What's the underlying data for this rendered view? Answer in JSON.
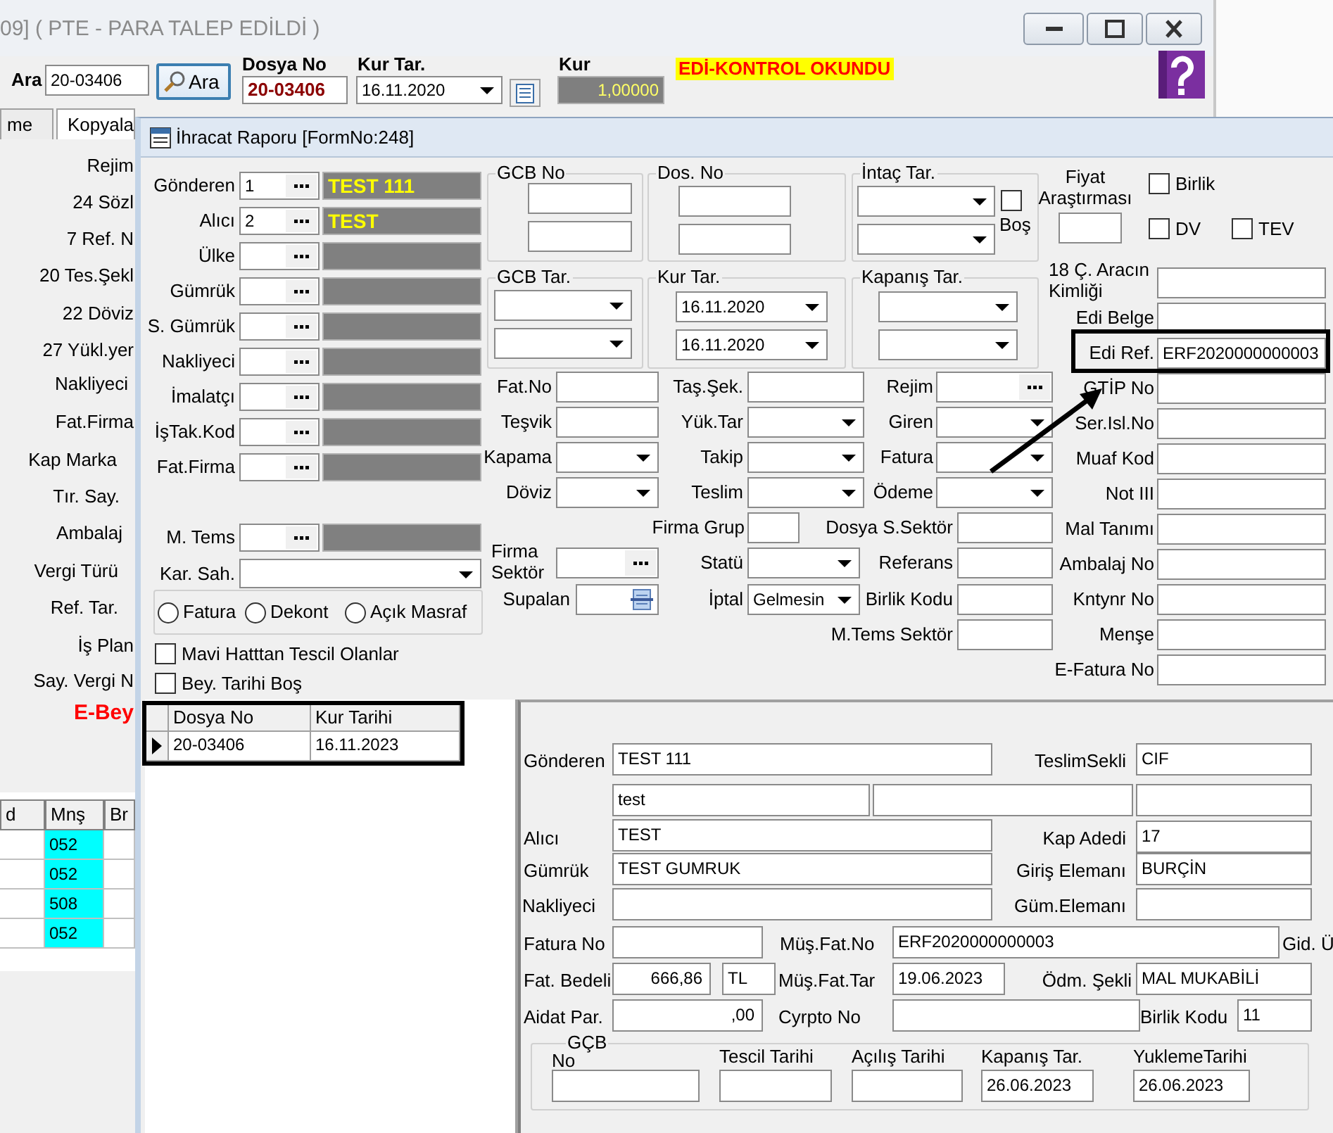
{
  "main_window": {
    "title": "09] ( PTE - PARA TALEP EDİLDİ )"
  },
  "toolbar": {
    "search_label": "Ara",
    "search_value": "20-03406",
    "search_button": "Ara",
    "file_no_label": "Dosya No",
    "file_no": "20-03406",
    "rate_date_label": "Kur Tar.",
    "rate_date": "16.11.2020",
    "rate_label": "Kur",
    "rate": "1,00000",
    "status": "EDİ-KONTROL OKUNDU"
  },
  "main_tabs": [
    {
      "label": "me",
      "selected": false
    },
    {
      "label": "Kopyala",
      "selected": true
    }
  ],
  "main_labels": [
    {
      "text": "Rejim",
      "kind": "normal"
    },
    {
      "text": "24 Sözl",
      "kind": "normal"
    },
    {
      "text": "7 Ref. N",
      "kind": "normal"
    },
    {
      "text": "20 Tes.Şekl",
      "kind": "normal"
    },
    {
      "text": "22 Döviz",
      "kind": "normal"
    },
    {
      "text": "27 Yükl.yer",
      "kind": "normal"
    },
    {
      "text": "Nakliyeci",
      "kind": "normal"
    },
    {
      "text": "Fat.Firma",
      "kind": "normal"
    },
    {
      "text": "Kap Marka",
      "kind": "normal"
    },
    {
      "text": "Tır. Say.",
      "kind": "normal"
    },
    {
      "text": "Ambalaj",
      "kind": "normal"
    },
    {
      "text": "Vergi Türü",
      "kind": "normal"
    },
    {
      "text": "Ref. Tar.",
      "kind": "normal"
    },
    {
      "text": "İş Plan",
      "kind": "normal"
    },
    {
      "text": "Say. Vergi N",
      "kind": "normal"
    },
    {
      "text": "E-Bey",
      "kind": "alert"
    }
  ],
  "main_grid": {
    "columns": [
      "d",
      "Mnş",
      "Br"
    ],
    "rows": [
      {
        "mns": "052"
      },
      {
        "mns": "052"
      },
      {
        "mns": "508"
      },
      {
        "mns": "052"
      }
    ]
  },
  "dialog": {
    "title": "İhracat Raporu [FormNo:248]",
    "parties": [
      {
        "label": "Gönderen",
        "code": "1",
        "name": "TEST 111"
      },
      {
        "label": "Alıcı",
        "code": "2",
        "name": "TEST"
      },
      {
        "label": "Ülke"
      },
      {
        "label": "Gümrük"
      },
      {
        "label": "S. Gümrük"
      },
      {
        "label": "Nakliyeci"
      },
      {
        "label": "İmalatçı"
      },
      {
        "label": "İşTak.Kod"
      },
      {
        "label": "Fat.Firma"
      },
      {
        "label": "M. Tems"
      }
    ],
    "owner": {
      "label": "Kar. Sah."
    },
    "doc_types": [
      {
        "label": "Fatura",
        "selected": false
      },
      {
        "label": "Dekont",
        "selected": false
      },
      {
        "label": "Açık Masraf",
        "selected": false
      }
    ],
    "filters": [
      {
        "label": "Mavi Hatttan Tescil Olanlar",
        "checked": false
      },
      {
        "label": "Bey. Tarihi Boş",
        "checked": false
      }
    ],
    "range_groups": [
      {
        "title": "GCB No",
        "kind": "text"
      },
      {
        "title": "Dos. No",
        "kind": "text"
      },
      {
        "title": "İntaç Tar.",
        "kind": "date",
        "empty_option": {
          "label": "Boş",
          "checked": false
        }
      },
      {
        "title": "GCB Tar.",
        "kind": "date"
      },
      {
        "title": "Kur Tar.",
        "kind": "date",
        "values": [
          "16.11.2020",
          "16.11.2020"
        ]
      },
      {
        "title": "Kapanış Tar.",
        "kind": "date"
      }
    ],
    "fields": [
      {
        "label": "Fat.No",
        "kind": "text"
      },
      {
        "label": "Taş.Şek.",
        "kind": "text"
      },
      {
        "label": "Rejim",
        "kind": "lookup"
      },
      {
        "label": "Teşvik",
        "kind": "text"
      },
      {
        "label": "Yük.Tar",
        "kind": "combo"
      },
      {
        "label": "Giren",
        "kind": "combo"
      },
      {
        "label": "Kapama",
        "kind": "combo"
      },
      {
        "label": "Takip",
        "kind": "combo"
      },
      {
        "label": "Fatura",
        "kind": "combo"
      },
      {
        "label": "Döviz",
        "kind": "combo"
      },
      {
        "label": "Teslim",
        "kind": "combo"
      },
      {
        "label": "Ödeme",
        "kind": "combo"
      },
      {
        "label": "Firma Grup",
        "kind": "text"
      },
      {
        "label": "Dosya S.Sektör",
        "kind": "text"
      },
      {
        "label": "Firma Sektör",
        "kind": "lookup"
      },
      {
        "label": "Statü",
        "kind": "combo"
      },
      {
        "label": "Referans",
        "kind": "text"
      },
      {
        "label": "Supalan",
        "kind": "picker"
      },
      {
        "label": "İptal",
        "kind": "combo",
        "value": "Gelmesin"
      },
      {
        "label": "Birlik Kodu",
        "kind": "text"
      },
      {
        "label": "M.Tems Sektör",
        "kind": "text"
      }
    ],
    "price_survey": {
      "label": "Fiyat Araştırması"
    },
    "flags": [
      {
        "label": "Birlik",
        "checked": false
      },
      {
        "label": "DV",
        "checked": false
      },
      {
        "label": "TEV",
        "checked": false
      }
    ],
    "edi_fields": [
      {
        "label": "18 Ç. Aracın Kimliği",
        "highlighted": false
      },
      {
        "label": "Edi Belge",
        "highlighted": false
      },
      {
        "label": "Edi Ref.",
        "value": "ERF2020000000003",
        "highlighted": true
      },
      {
        "label": "GTİP No",
        "highlighted": false
      },
      {
        "label": "Ser.Isl.No",
        "highlighted": false
      },
      {
        "label": "Muaf Kod",
        "highlighted": false
      },
      {
        "label": "Not III",
        "highlighted": false
      },
      {
        "label": "Mal Tanımı",
        "highlighted": false
      },
      {
        "label": "Ambalaj No",
        "highlighted": false
      },
      {
        "label": "Kntynr No",
        "highlighted": false
      },
      {
        "label": "Menşe",
        "highlighted": false
      },
      {
        "label": "E-Fatura No",
        "highlighted": false
      }
    ],
    "file_list": {
      "highlighted": true,
      "columns": [
        "Dosya No",
        "Kur Tarihi"
      ],
      "rows": [
        {
          "cells": [
            "20-03406",
            "16.11.2023"
          ],
          "selected": true
        }
      ]
    },
    "details": {
      "fields": [
        {
          "label": "Gönderen",
          "value": "TEST 111",
          "kind": "text"
        },
        {
          "label": "TeslimSekli",
          "value": "CIF",
          "kind": "text"
        },
        {
          "value": "test",
          "kind": "text"
        },
        {
          "kind": "text"
        },
        {
          "kind": "text"
        },
        {
          "label": "Alıcı",
          "value": "TEST",
          "kind": "text"
        },
        {
          "label": "Kap Adedi",
          "value": "17",
          "kind": "text"
        },
        {
          "label": "Gümrük",
          "value": "TEST GUMRUK",
          "kind": "text"
        },
        {
          "label": "Giriş Elemanı",
          "value": "BURÇİN",
          "kind": "text"
        },
        {
          "label": "Nakliyeci",
          "kind": "text"
        },
        {
          "label": "Güm.Elemanı",
          "kind": "text"
        },
        {
          "label": "Fatura No",
          "kind": "text"
        },
        {
          "label": "Müş.Fat.No",
          "value": "ERF2020000000003",
          "kind": "text"
        },
        {
          "label": "Gid. Ü",
          "kind": "label"
        },
        {
          "label": "Fat. Bedeli",
          "value": "666,86",
          "kind": "number"
        },
        {
          "value": "TL",
          "kind": "text"
        },
        {
          "label": "Müş.Fat.Tar",
          "value": "19.06.2023",
          "kind": "text"
        },
        {
          "label": "Ödm. Şekli",
          "value": "MAL MUKABİLİ",
          "kind": "text"
        },
        {
          "label": "Aidat Par.",
          "value": ",00",
          "kind": "number"
        },
        {
          "label": "Cyrpto No",
          "kind": "text"
        },
        {
          "label": "Birlik Kodu",
          "value": "11",
          "kind": "text"
        }
      ],
      "gcb_group": {
        "title": "GÇB",
        "fields": [
          {
            "label": "No"
          },
          {
            "label": "Tescil Tarihi"
          },
          {
            "label": "Açılış Tarihi"
          },
          {
            "label": "Kapanış Tar.",
            "value": "26.06.2023"
          },
          {
            "label": "YuklemeTarihi",
            "value": "26.06.2023"
          }
        ]
      }
    }
  }
}
